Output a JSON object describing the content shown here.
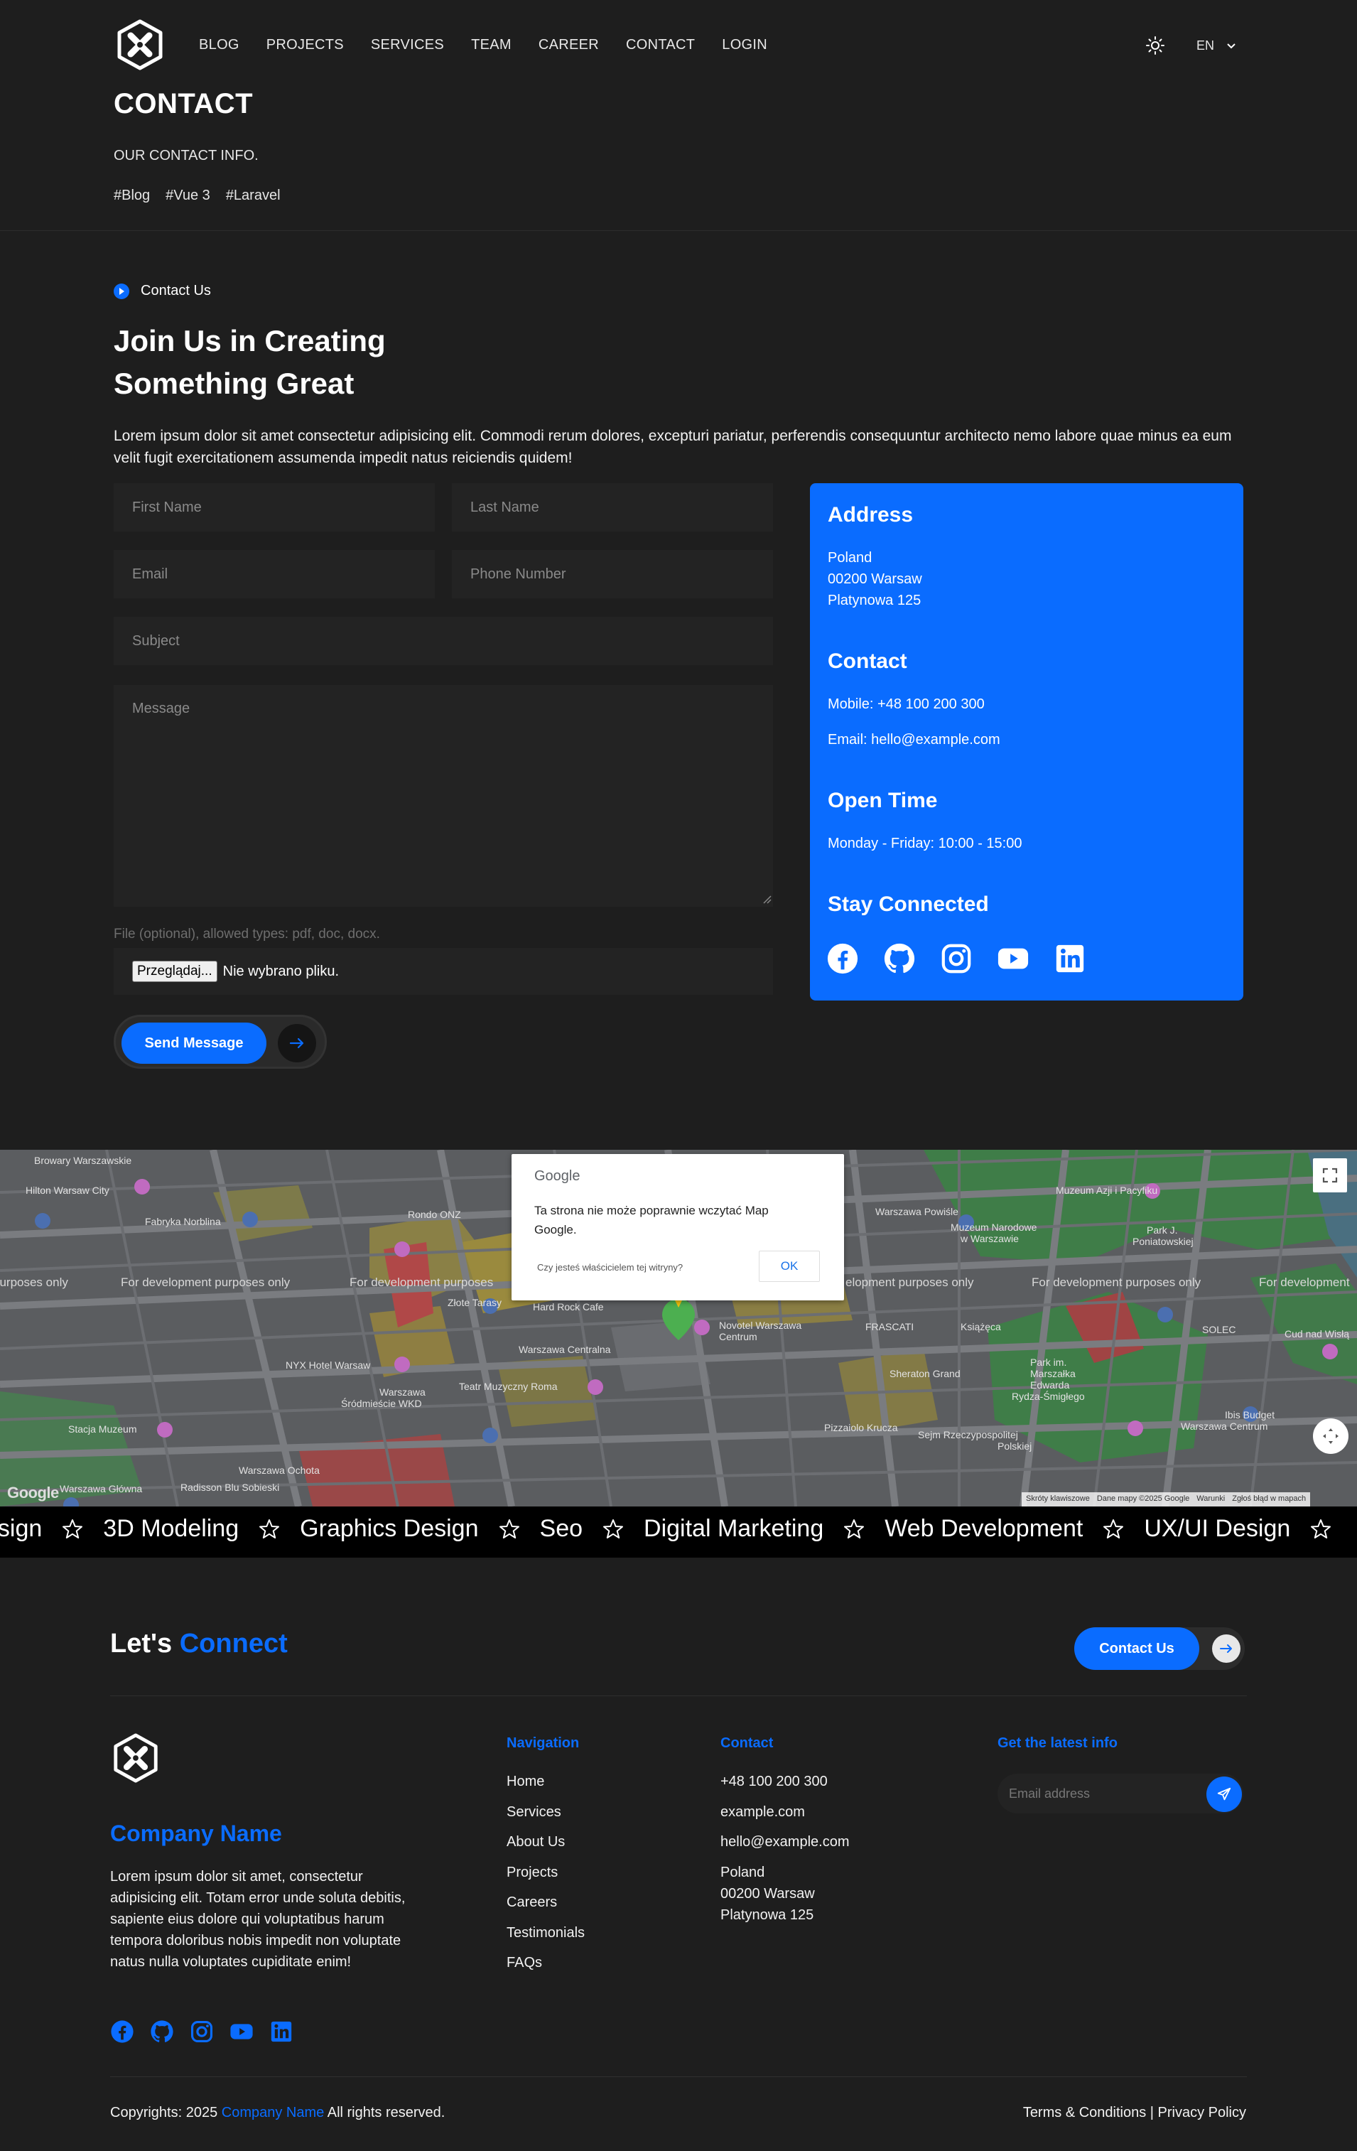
{
  "header": {
    "nav": [
      "BLOG",
      "PROJECTS",
      "SERVICES",
      "TEAM",
      "CAREER",
      "CONTACT",
      "LOGIN"
    ],
    "lang": "EN",
    "title": "CONTACT",
    "subtitle": "OUR CONTACT INFO.",
    "tags": [
      "#Blog",
      "#Vue 3",
      "#Laravel"
    ]
  },
  "contact_section": {
    "eyebrow": "Contact Us",
    "headline": "Join Us in Creating Something Great",
    "lead": "Lorem ipsum dolor sit amet consectetur adipisicing elit. Commodi rerum dolores, excepturi pariatur, perferendis consequuntur architecto nemo labore quae minus ea eum velit fugit exercitationem assumenda impedit natus reiciendis quidem!",
    "form": {
      "first_name_placeholder": "First Name",
      "last_name_placeholder": "Last Name",
      "email_placeholder": "Email",
      "phone_placeholder": "Phone Number",
      "subject_placeholder": "Subject",
      "message_placeholder": "Message",
      "file_hint": "File (optional), allowed types: pdf, doc, docx.",
      "file_button": "Przeglądaj...",
      "file_status": "Nie wybrano pliku.",
      "send_label": "Send Message"
    }
  },
  "info_card": {
    "address_title": "Address",
    "address_lines": [
      "Poland",
      "00200 Warsaw",
      "Platynowa 125"
    ],
    "contact_title": "Contact",
    "mobile": "Mobile: +48 100 200 300",
    "email": "Email: hello@example.com",
    "open_title": "Open Time",
    "open_hours": "Monday - Friday: 10:00 - 15:00",
    "connected_title": "Stay Connected",
    "socials": [
      "facebook-icon",
      "github-icon",
      "instagram-icon",
      "youtube-icon",
      "linkedin-icon"
    ]
  },
  "map": {
    "dialog_brand": "Google",
    "dialog_message": "Ta strona nie może poprawnie wczytać Map Google.",
    "dialog_owner_q": "Czy jesteś właścicielem tej witryny?",
    "dialog_ok": "OK",
    "dev_watermark": "For development purposes only",
    "logo": "Google",
    "attribution": [
      "Skróty klawiszowe",
      "Dane mapy ©2025 Google",
      "Warunki",
      "Zgłoś błąd w mapach"
    ],
    "labels": [
      "Browary Warszawskie",
      "Hilton Warsaw City",
      "Fabryka Norblina",
      "Rondo ONZ",
      "Hard Rock Cafe",
      "Novotel Warszawa Centrum",
      "Warszawa Centralna",
      "Teatr Muzyczny Roma",
      "NYX Hotel Warsaw",
      "Warszawa Śródmieście WKD",
      "Warszawa Ochota",
      "Radisson Blu Sobieski",
      "Muzeum Azji i Pacyfiku",
      "Muzeum Narodowe w Warszawie",
      "Park J. Poniatowskiej",
      "FRASCATI",
      "Książęca",
      "SOLEC",
      "Sheraton Grand",
      "Park im. Marszałka Edwarda Rydza-Śmigłego",
      "Sejm Rzeczypospolitej Polskiej",
      "Pizzaiolo Krucza",
      "Ibis Budget Warszawa Centrum",
      "Warszawa Powiśle",
      "Stacja Muzeum",
      "Złote Tarasy",
      "Warszawa Główna",
      "Cud nad Wisłą"
    ]
  },
  "ticker": [
    "esign",
    "3D Modeling",
    "Graphics Design",
    "Seo",
    "Digital Marketing",
    "Web Development",
    "UX/UI Design"
  ],
  "footer": {
    "connect_prefix": "Let's",
    "connect_highlight": "Connect",
    "contact_button": "Contact Us",
    "company_name": "Company Name",
    "about": "Lorem ipsum dolor sit amet, consectetur adipisicing elit. Totam error unde soluta debitis, sapiente eius dolore qui voluptatibus harum tempora doloribus nobis impedit non voluptate natus nulla voluptates cupiditate enim!",
    "nav_title": "Navigation",
    "nav_items": [
      "Home",
      "Services",
      "About Us",
      "Projects",
      "Careers",
      "Testimonials",
      "FAQs"
    ],
    "contact_title": "Contact",
    "contact_items": [
      "+48 100 200 300",
      "example.com",
      "hello@example.com"
    ],
    "contact_address": [
      "Poland",
      "00200 Warsaw",
      "Platynowa 125"
    ],
    "newsletter_title": "Get the latest info",
    "newsletter_placeholder": "Email address",
    "copyright_prefix": "Copyrights: 2025",
    "copyright_company": "Company Name",
    "copyright_suffix": "All rights reserved.",
    "legal": "Terms & Conditions | Privacy Policy"
  },
  "colors": {
    "accent": "#0a6cff",
    "bg": "#1e1e1e",
    "field": "#232323"
  }
}
